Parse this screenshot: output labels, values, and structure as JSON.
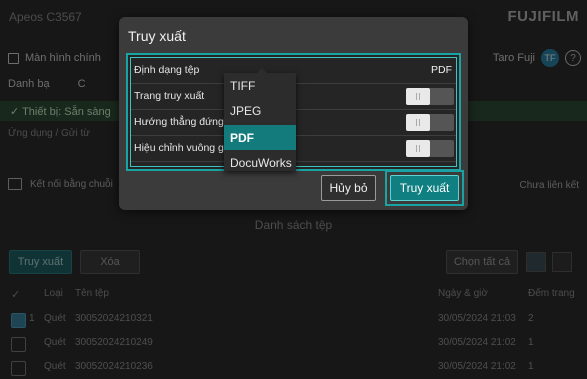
{
  "background": {
    "device_name": "Apeos C3567",
    "brand": "FUJIFILM",
    "home_label": "Màn hình chính",
    "user_name": "Taro Fuji",
    "user_badge": "TF",
    "help_glyph": "?",
    "contacts_label": "Danh bạ",
    "contacts_other_label": "C",
    "status_text": "✓ Thiết bị: Sẵn sàng",
    "breadcrumb": "Ứng dụng / Gửi từ",
    "connect_label": "Kết nối bằng chuỗi",
    "connection_state": "Chưa liên kết",
    "list_title": "Danh sách tệp",
    "buttons": {
      "retrieve": "Truy xuất",
      "delete": "Xóa",
      "select_all": "Chọn tất cả"
    },
    "columns": {
      "type": "Loại",
      "filename": "Tên tệp",
      "datetime": "Ngày & giờ",
      "pages": "Đếm trang"
    },
    "rows": [
      {
        "index": "1",
        "type": "Quét",
        "filename": "30052024210321",
        "datetime": "30/05/2024 21:03",
        "pages": "2",
        "checked": true
      },
      {
        "index": "",
        "type": "Quét",
        "filename": "30052024210249",
        "datetime": "30/05/2024 21:02",
        "pages": "1",
        "checked": false
      },
      {
        "index": "",
        "type": "Quét",
        "filename": "30052024210236",
        "datetime": "30/05/2024 21:02",
        "pages": "1",
        "checked": false
      }
    ]
  },
  "dialog": {
    "title": "Truy xuất",
    "settings": [
      {
        "label": "Định dạng tệp",
        "value": "PDF"
      },
      {
        "label": "Trang truy xuất",
        "toggle": "off"
      },
      {
        "label": "Hướng thẳng đứng t",
        "toggle": "off"
      },
      {
        "label": "Hiệu chỉnh vuông gó",
        "toggle": "off"
      }
    ],
    "format_options": [
      "TIFF",
      "JPEG",
      "PDF",
      "DocuWorks"
    ],
    "selected_format": "PDF",
    "cancel_label": "Hủy bỏ",
    "retrieve_label": "Truy xuất"
  },
  "colors": {
    "accent": "#0f7f82",
    "highlight": "#1aa3a3",
    "dialog_bg": "#3b3b3b"
  }
}
